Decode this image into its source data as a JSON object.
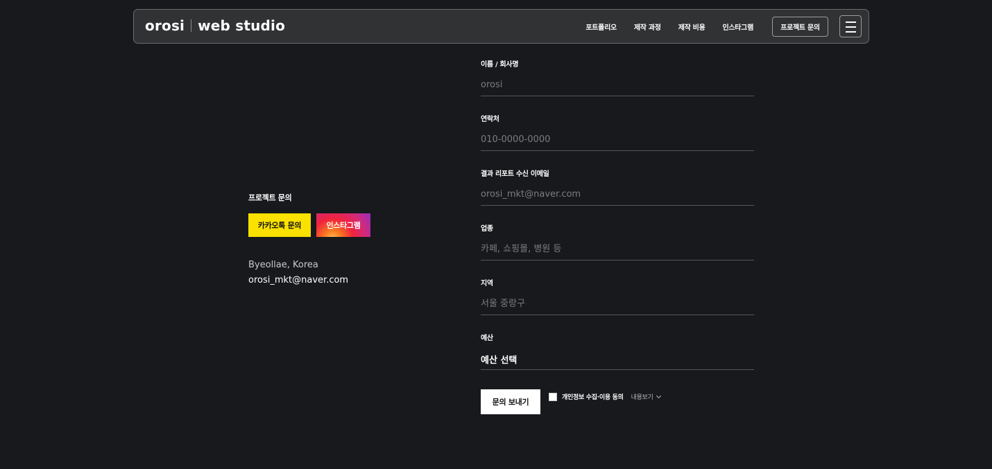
{
  "header": {
    "logo_left": "orosi",
    "logo_right": "web studio",
    "nav": [
      "포트폴리오",
      "제작 과정",
      "제작 비용",
      "인스타그램"
    ],
    "cta": "프로젝트 문의"
  },
  "contact": {
    "title": "프로젝트 문의",
    "kakao_label": "카카오톡 문의",
    "insta_label": "인스타그램",
    "address": "Byeollae, Korea",
    "email": "orosi_mkt@naver.com"
  },
  "form": {
    "fields": [
      {
        "label": "이름 / 회사명",
        "placeholder": "orosi"
      },
      {
        "label": "연락처",
        "placeholder": "010-0000-0000"
      },
      {
        "label": "결과 리포트 수신 이메일",
        "placeholder": "orosi_mkt@naver.com"
      },
      {
        "label": "업종",
        "placeholder": "카페, 쇼핑몰, 병원 등"
      },
      {
        "label": "지역",
        "placeholder": "서울 중랑구"
      }
    ],
    "budget_label": "예산",
    "budget_value": "예산 선택",
    "submit": "문의 보내기",
    "agree_label": "개인정보 수집·이용 동의",
    "view_more": "내용보기"
  },
  "colors": {
    "background": "#17191c",
    "header_bg": "#303234",
    "kakao": "#fae100"
  }
}
